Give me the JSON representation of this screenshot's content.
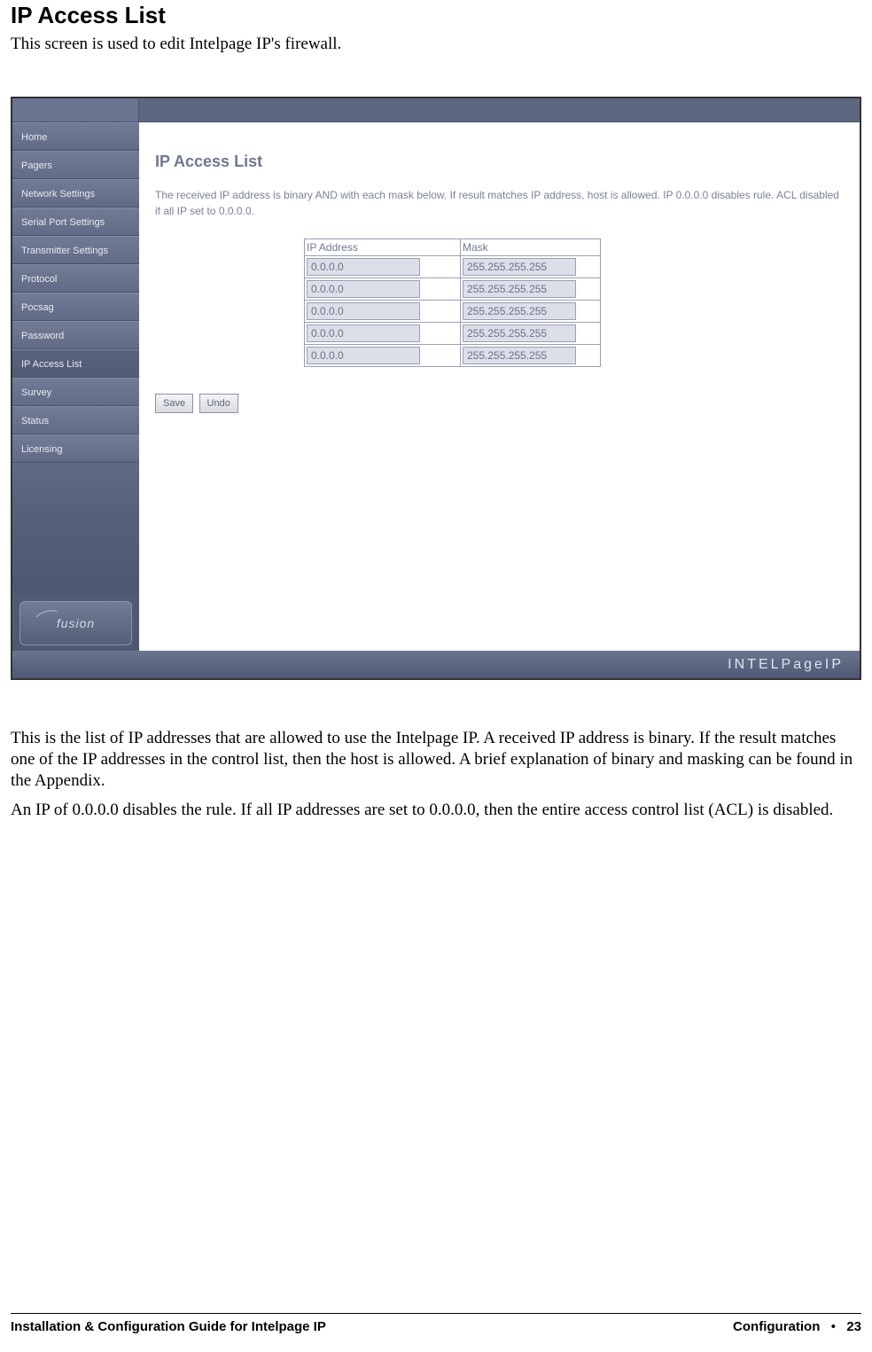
{
  "page": {
    "title": "IP Access List",
    "intro": "This screen is used to edit Intelpage IP's firewall."
  },
  "sidebar": {
    "items": [
      {
        "label": "Home"
      },
      {
        "label": "Pagers"
      },
      {
        "label": "Network Settings"
      },
      {
        "label": "Serial Port Settings"
      },
      {
        "label": "Transmitter Settings"
      },
      {
        "label": "Protocol"
      },
      {
        "label": "Pocsag"
      },
      {
        "label": "Password"
      },
      {
        "label": "IP Access List"
      },
      {
        "label": "Survey"
      },
      {
        "label": "Status"
      },
      {
        "label": "Licensing"
      }
    ],
    "logo_text": "fusion"
  },
  "content": {
    "heading": "IP Access List",
    "description": "The received IP address is binary AND with each mask below.  If result matches IP address, host is allowed. IP 0.0.0.0 disables rule. ACL disabled if all IP set to 0.0.0.0.",
    "table": {
      "col_ip": "IP Address",
      "col_mask": "Mask",
      "rows": [
        {
          "ip": "0.0.0.0",
          "mask": "255.255.255.255"
        },
        {
          "ip": "0.0.0.0",
          "mask": "255.255.255.255"
        },
        {
          "ip": "0.0.0.0",
          "mask": "255.255.255.255"
        },
        {
          "ip": "0.0.0.0",
          "mask": "255.255.255.255"
        },
        {
          "ip": "0.0.0.0",
          "mask": "255.255.255.255"
        }
      ]
    },
    "save_label": "Save",
    "undo_label": "Undo",
    "footer_brand": "INTELPageIP"
  },
  "body": {
    "para1": "This is the list of IP addresses that are allowed to use the Intelpage IP. A received IP address is binary. If the result matches one of the IP addresses in the control list, then the host is allowed. A brief explanation of binary and masking can be found in the Appendix.",
    "para2": "An IP of 0.0.0.0 disables the rule. If all IP addresses are set to 0.0.0.0, then the entire access control list (ACL) is disabled."
  },
  "footer": {
    "left": "Installation & Configuration Guide for Intelpage IP",
    "right_section": "Configuration",
    "right_page": "23"
  }
}
